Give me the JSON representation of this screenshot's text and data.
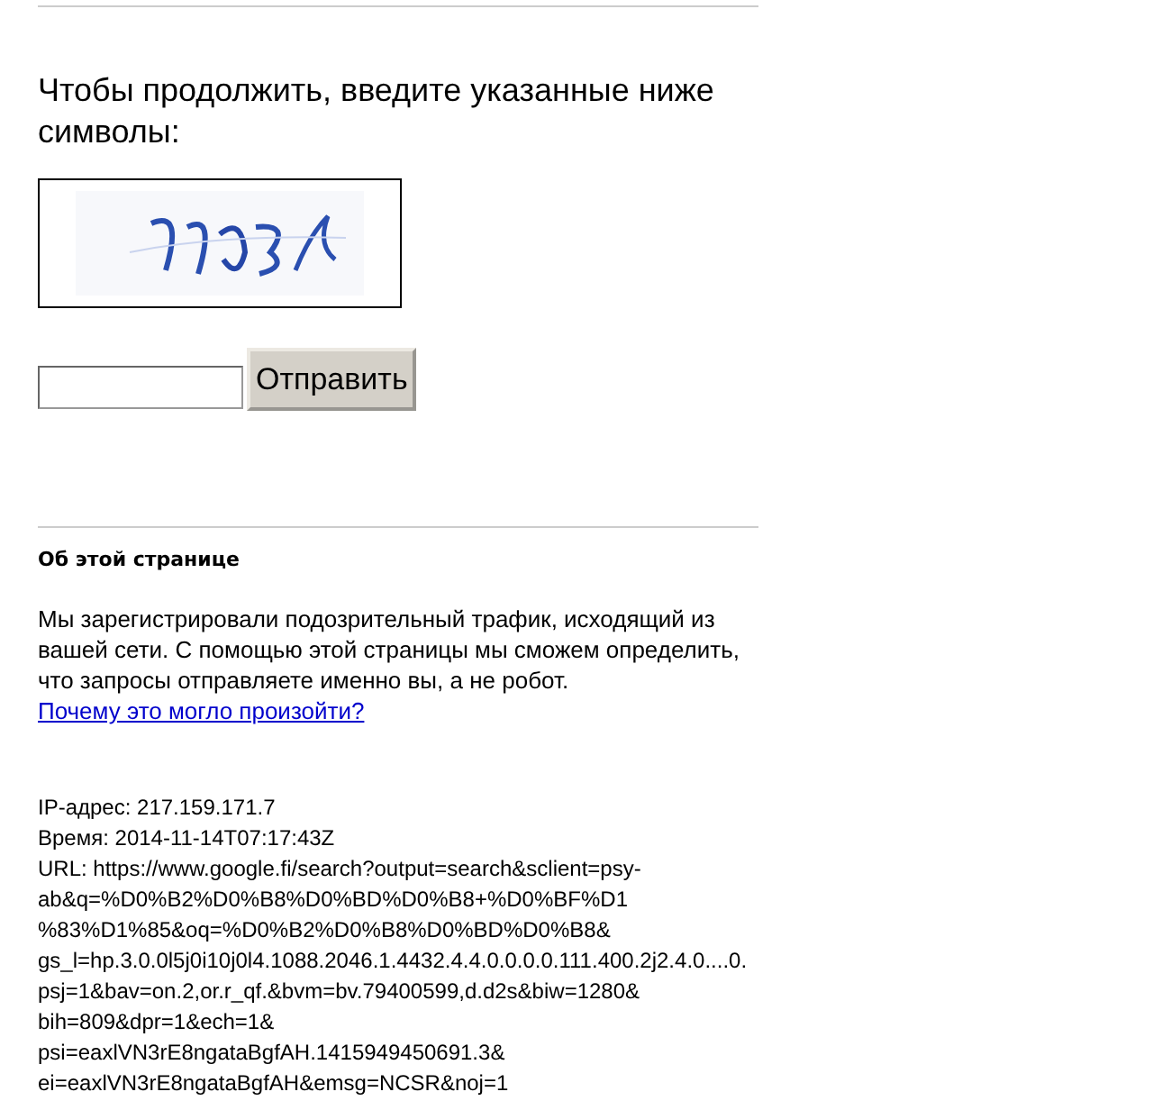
{
  "prompt": {
    "heading": "Чтобы продолжить, введите указанные ниже символы:",
    "submit": "Отправить"
  },
  "about": {
    "title": "Об этой странице",
    "text": "Мы зарегистрировали подозрительный трафик, исходящий из вашей сети. С помощью этой страницы мы сможем определить, что запросы отправляете именно вы, а не робот.",
    "link": "Почему это могло произойти?"
  },
  "details": [
    "IP-адрес: 217.159.171.7",
    "Время: 2014-11-14T07:17:43Z",
    "URL: https://www.google.fi/search?output=search&sclient=psy-",
    "ab&q=%D0%B2%D0%B8%D0%BD%D0%B8+%D0%BF%D1",
    "%83%D1%85&oq=%D0%B2%D0%B8%D0%BD%D0%B8&",
    "gs_l=hp.3.0.0l5j0i10j0l4.1088.2046.1.4432.4.4.0.0.0.0.111.400.2j2.4.0....0.",
    "psj=1&bav=on.2,or.r_qf.&bvm=bv.79400599,d.d2s&biw=1280&",
    "bih=809&dpr=1&ech=1&",
    "psi=eaxlVN3rE8ngataBgfAH.1415949450691.3&",
    "ei=eaxlVN3rE8ngataBgfAH&emsg=NCSR&noj=1"
  ]
}
